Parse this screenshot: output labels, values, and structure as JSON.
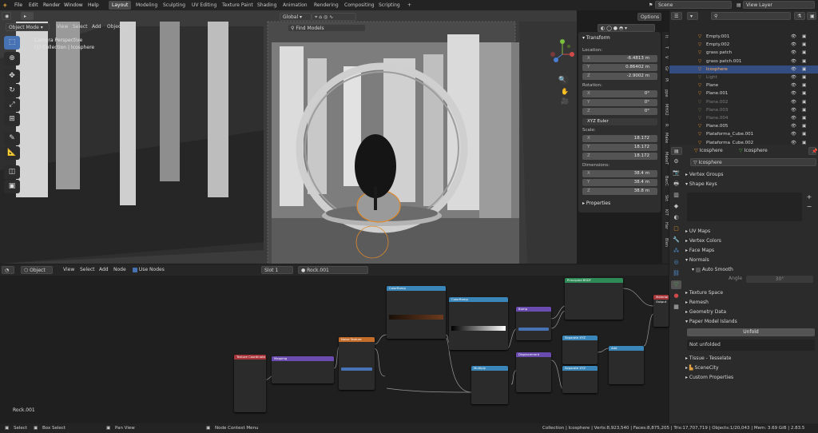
{
  "topbar": {
    "menus": [
      "File",
      "Edit",
      "Render",
      "Window",
      "Help"
    ],
    "workspaces": [
      "Layout",
      "Modeling",
      "Sculpting",
      "UV Editing",
      "Texture Paint",
      "Shading",
      "Animation",
      "Rendering",
      "Compositing",
      "Scripting"
    ],
    "active_workspace": "Layout",
    "scene_label": "Scene",
    "view_layer_label": "View Layer"
  },
  "viewport": {
    "mode": "Object Mode",
    "menus": [
      "View",
      "Select",
      "Add",
      "Object"
    ],
    "orientation": "Global",
    "info_line1": "Camera Perspective",
    "info_line2": "(1) Collection | Icosphere",
    "options_label": "Options",
    "find_label": "Find Models"
  },
  "transform_panel": {
    "title": "Transform",
    "location_label": "Location:",
    "location": [
      {
        "k": "X",
        "v": "-6.4813 m"
      },
      {
        "k": "Y",
        "v": "0.86402 m"
      },
      {
        "k": "Z",
        "v": "-2.9002 m"
      }
    ],
    "rotation_label": "Rotation:",
    "rotation": [
      {
        "k": "X",
        "v": "0°"
      },
      {
        "k": "Y",
        "v": "0°"
      },
      {
        "k": "Z",
        "v": "0°"
      }
    ],
    "rotation_mode": "XYZ Euler",
    "scale_label": "Scale:",
    "scale": [
      {
        "k": "X",
        "v": "18.172"
      },
      {
        "k": "Y",
        "v": "18.172"
      },
      {
        "k": "Z",
        "v": "18.172"
      }
    ],
    "dimensions_label": "Dimensions:",
    "dimensions": [
      {
        "k": "X",
        "v": "38.4 m"
      },
      {
        "k": "Y",
        "v": "38.4 m"
      },
      {
        "k": "Z",
        "v": "38.8 m"
      }
    ],
    "properties_label": "Properties"
  },
  "n_tabs": [
    "It",
    "T",
    "V",
    "Gr",
    "Pl",
    "ppe",
    "MHX2",
    "R",
    "Make",
    "MakeT",
    "BacC",
    "Skt",
    "KIT",
    "Har",
    "Blen"
  ],
  "outliner": {
    "items": [
      {
        "name": "Empty.001",
        "dim": false,
        "sel": false
      },
      {
        "name": "Empty.002",
        "dim": false,
        "sel": false
      },
      {
        "name": "grass patch",
        "dim": false,
        "sel": false
      },
      {
        "name": "grass patch.001",
        "dim": false,
        "sel": false
      },
      {
        "name": "Icosphere",
        "dim": false,
        "sel": true
      },
      {
        "name": "Light",
        "dim": true,
        "sel": false
      },
      {
        "name": "Plane",
        "dim": false,
        "sel": false
      },
      {
        "name": "Plane.001",
        "dim": false,
        "sel": false
      },
      {
        "name": "Plane.002",
        "dim": true,
        "sel": false
      },
      {
        "name": "Plane.003",
        "dim": true,
        "sel": false
      },
      {
        "name": "Plane.004",
        "dim": true,
        "sel": false
      },
      {
        "name": "Plane.005",
        "dim": false,
        "sel": false
      },
      {
        "name": "Plataforma_Cube.001",
        "dim": false,
        "sel": false
      },
      {
        "name": "Plataforma_Cube.002",
        "dim": false,
        "sel": false
      }
    ]
  },
  "properties": {
    "object_name": "Icosphere",
    "mesh_name": "Icosphere",
    "data_name": "Icosphere",
    "sections": {
      "vertex_groups": "Vertex Groups",
      "shape_keys": "Shape Keys",
      "uv_maps": "UV Maps",
      "vertex_colors": "Vertex Colors",
      "face_maps": "Face Maps",
      "normals": "Normals",
      "auto_smooth": "Auto Smooth",
      "angle_label": "Angle",
      "angle_value": "30°",
      "texture_space": "Texture Space",
      "remesh": "Remesh",
      "geometry_data": "Geometry Data",
      "paper_model": "Paper Model Islands",
      "unfold": "Unfold",
      "not_unfolded": "Not unfolded",
      "tissue": "Tissue - Tesselate",
      "scenecity": "SceneCity",
      "custom_props": "Custom Properties"
    }
  },
  "node_editor": {
    "type": "Object",
    "menus": [
      "View",
      "Select",
      "Add",
      "Node"
    ],
    "use_nodes": "Use Nodes",
    "slot": "Slot 1",
    "material": "Rock.001",
    "footer_name": "Rock.001",
    "nodes": {
      "texcoord": "Texture Coordinate",
      "mapping": "Mapping",
      "noise": "Noise Texture",
      "colorramp1": "ColorRamp",
      "colorramp2": "ColorRamp",
      "bump": "Bump",
      "principled": "Principled BSDF",
      "output": "Material Output",
      "displacement": "Displacement",
      "multiply": "Multiply",
      "separate1": "Separate XYZ",
      "separate2": "Separate XYZ",
      "add": "Add"
    }
  },
  "status": {
    "select": "Select",
    "box_select": "Box Select",
    "pan_view": "Pan View",
    "context_menu": "Node Context Menu",
    "stats": "Collection | Icosphere | Verts:8,923,540 | Faces:8,875,205 | Tris:17,707,719 | Objects:1/20,043 | Mem: 3.69 GiB | 2.83.5"
  },
  "colors": {
    "accent": "#4772b3",
    "selected_row": "#334d80",
    "node_input": "#a6363a",
    "node_vector": "#6a4bb0",
    "node_texture": "#c46c2a",
    "node_converter": "#3a86b8",
    "node_shader": "#2e8b57"
  }
}
